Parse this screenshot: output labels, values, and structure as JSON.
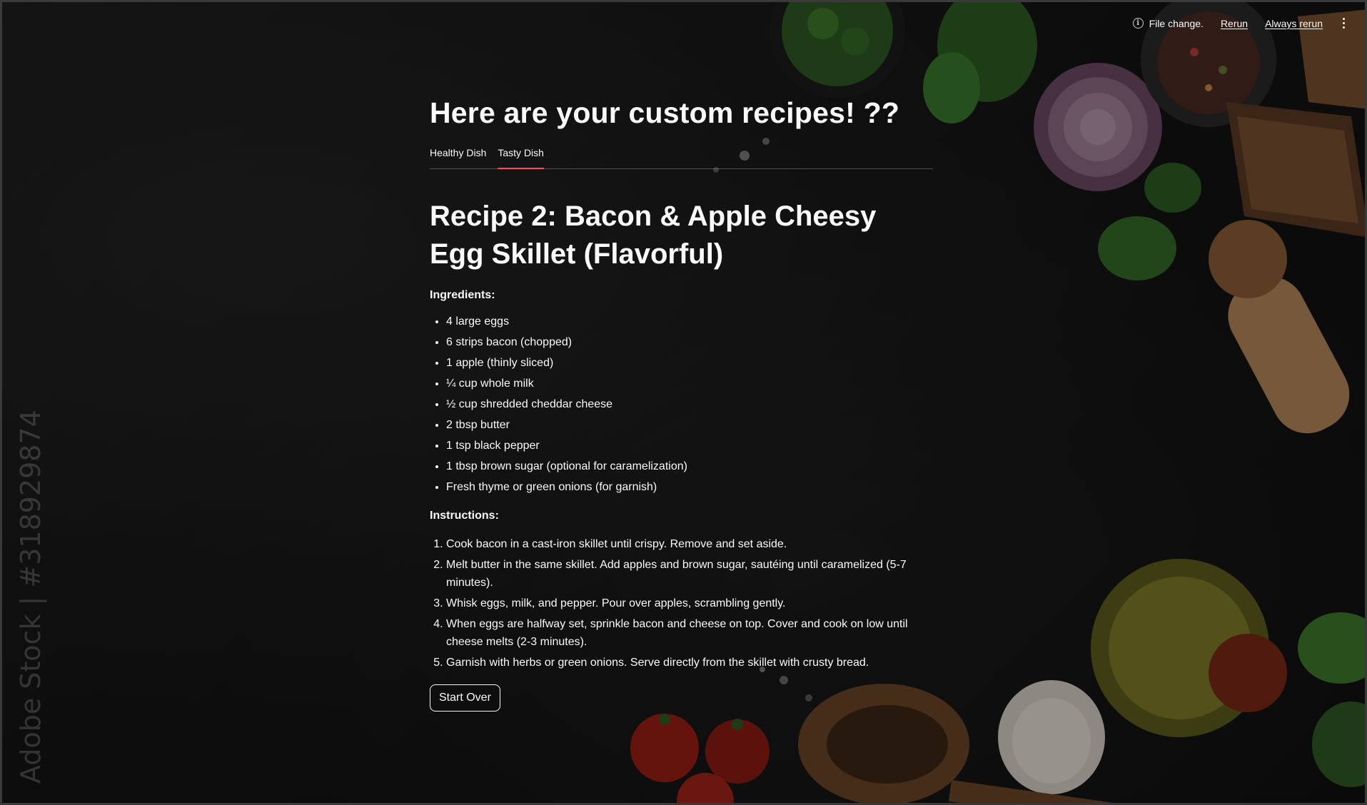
{
  "toolbar": {
    "status_icon": "info-icon",
    "status_text": "File change.",
    "rerun_label": "Rerun",
    "always_rerun_label": "Always rerun",
    "menu_icon": "kebab-menu-icon"
  },
  "main": {
    "page_title": "Here are your custom recipes! ??",
    "tabs": [
      {
        "label": "Healthy Dish",
        "active": false
      },
      {
        "label": "Tasty Dish",
        "active": true
      }
    ],
    "recipe_title": "Recipe 2: Bacon & Apple Cheesy Egg Skillet (Flavorful)",
    "ingredients_label": "Ingredients:",
    "ingredients": [
      "4 large eggs",
      "6 strips bacon (chopped)",
      "1 apple (thinly sliced)",
      "¼ cup whole milk",
      "½ cup shredded cheddar cheese",
      "2 tbsp butter",
      "1 tsp black pepper",
      "1 tbsp brown sugar (optional for caramelization)",
      "Fresh thyme or green onions (for garnish)"
    ],
    "instructions_label": "Instructions:",
    "instructions": [
      "Cook bacon in a cast-iron skillet until crispy. Remove and set aside.",
      "Melt butter in the same skillet. Add apples and brown sugar, sautéing until caramelized (5-7 minutes).",
      "Whisk eggs, milk, and pepper. Pour over apples, scrambling gently.",
      "When eggs are halfway set, sprinkle bacon and cheese on top. Cover and cook on low until cheese melts (2-3 minutes).",
      "Garnish with herbs or green onions. Serve directly from the skillet with crusty bread."
    ],
    "start_over_label": "Start Over"
  },
  "background": {
    "watermark_text": "Adobe Stock | #318929874"
  },
  "colors": {
    "accent": "#ff4b4b",
    "text": "#fafafa",
    "background": "#141414"
  }
}
